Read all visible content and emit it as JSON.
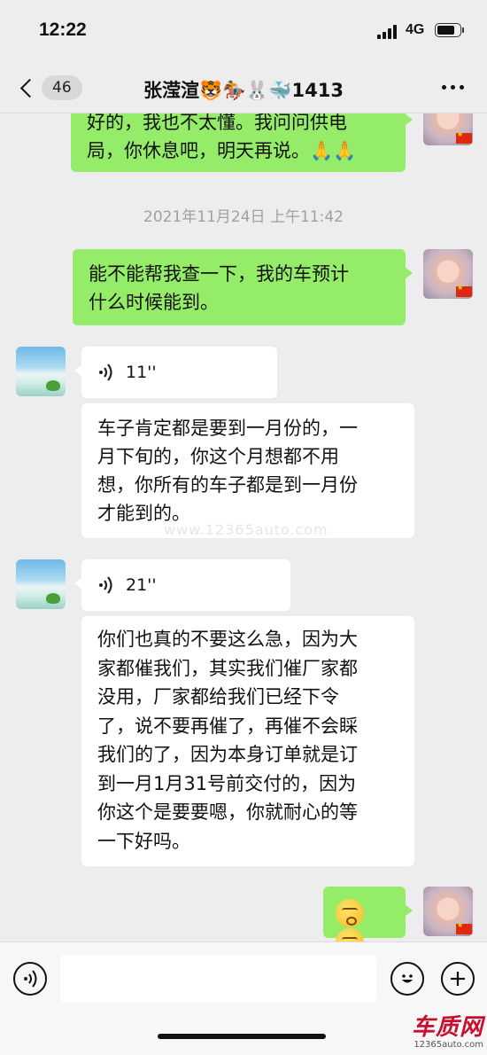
{
  "status_bar": {
    "time": "12:22",
    "network": "4G",
    "battery_level": 0.8
  },
  "nav": {
    "unread_count": "46",
    "title": "张滢渲🐯🏇🐰🐳1413"
  },
  "messages": [
    {
      "sender": "self",
      "type": "text",
      "lines": [
        "好的，我也不太懂。我问问供电",
        "局，你休息吧，明天再说。🙏🙏"
      ]
    },
    {
      "type": "timestamp",
      "text": "2021年11月24日 上午11:42"
    },
    {
      "sender": "self",
      "type": "text",
      "lines": [
        "能不能帮我查一下，我的车预计",
        "什么时候能到。"
      ]
    },
    {
      "sender": "other",
      "type": "voice",
      "duration": "11''"
    },
    {
      "sender": "other",
      "type": "text",
      "lines": [
        "车子肯定都是要到一月份的，一",
        "月下旬的，你这个月想都不用",
        "想，你所有的车子都是到一月份",
        "才能到的。"
      ]
    },
    {
      "sender": "other",
      "type": "voice",
      "duration": "21''"
    },
    {
      "sender": "other",
      "type": "text",
      "lines": [
        "你们也真的不要这么急，因为大",
        "家都催我们，其实我们催厂家都",
        "没用，厂家都给我们已经下令",
        "了，说不要再催了，再催不会睬",
        "我们的了，因为本身订单就是订",
        "到一月1月31号前交付的，因为",
        "你这个是要要嗯，你就耐心的等",
        "一下好吗。"
      ]
    },
    {
      "sender": "self",
      "type": "emoji",
      "emoji_name": "wry-face-emoji",
      "count": 2
    }
  ],
  "watermark": "www.12365auto.com",
  "input_bar": {
    "placeholder": "",
    "voice_icon": "voice-icon",
    "emoji_icon": "smile-icon",
    "plus_icon": "plus-icon"
  },
  "logo": {
    "main": "车质网",
    "sub": "12365auto.com"
  },
  "colors": {
    "self_bubble": "#95ec69",
    "other_bubble": "#ffffff",
    "background": "#ededed"
  }
}
